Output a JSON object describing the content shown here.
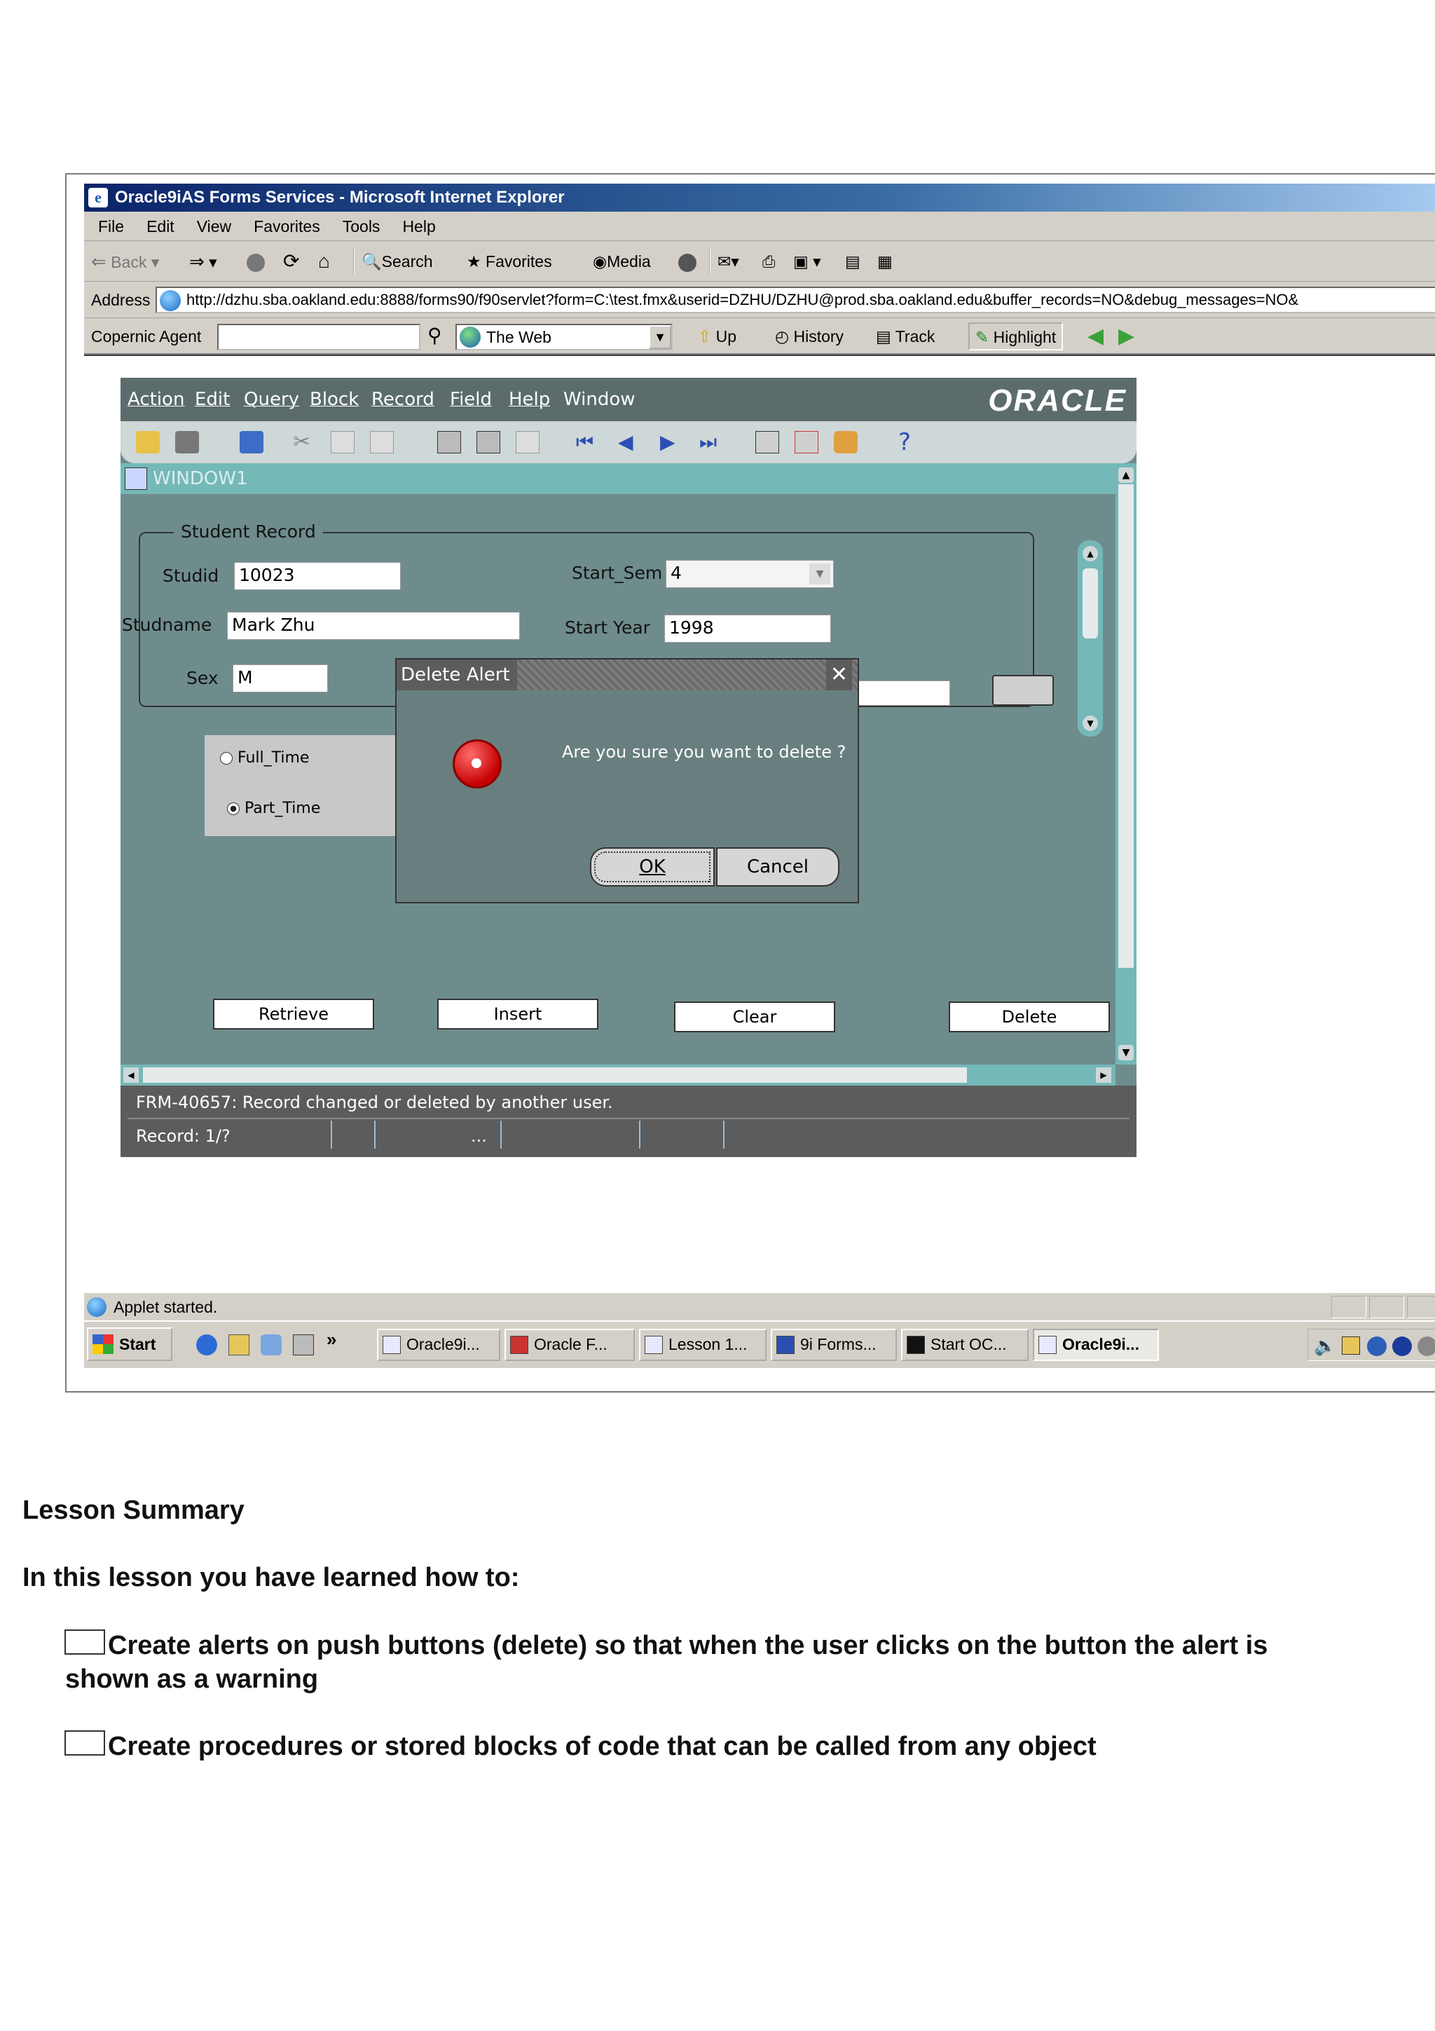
{
  "browser": {
    "title": "Oracle9iAS Forms Services - Microsoft Internet Explorer",
    "menu": [
      "File",
      "Edit",
      "View",
      "Favorites",
      "Tools",
      "Help"
    ],
    "toolbar": {
      "back": "Back",
      "search": "Search",
      "favorites": "Favorites",
      "media": "Media"
    },
    "address_label": "Address",
    "address_url": "http://dzhu.sba.oakland.edu:8888/forms90/f90servlet?form=C:\\test.fmx&userid=DZHU/DZHU@prod.sba.oakland.edu&buffer_records=NO&debug_messages=NO&",
    "links": {
      "agent_label": "Copernic Agent",
      "agent_scope": "The Web",
      "up": "Up",
      "history": "History",
      "track": "Track",
      "highlight": "Highlight"
    },
    "status": "Applet started."
  },
  "oracle_form": {
    "menu": [
      "Action",
      "Edit",
      "Query",
      "Block",
      "Record",
      "Field",
      "Help",
      "Window"
    ],
    "logo": "ORACLE",
    "window_title": "WINDOW1",
    "frame_title": "Student Record",
    "fields": {
      "studid_label": "Studid",
      "studid_value": "10023",
      "studname_label": "Studname",
      "studname_value": "Mark Zhu",
      "sex_label": "Sex",
      "sex_value": "M",
      "start_sem_label": "Start_Sem",
      "start_sem_value": "4",
      "start_year_label": "Start Year",
      "start_year_value": "1998"
    },
    "radio": {
      "full_time": "Full_Time",
      "part_time": "Part_Time",
      "selected": "Part_Time"
    },
    "buttons": {
      "retrieve": "Retrieve",
      "insert": "Insert",
      "clear": "Clear",
      "delete": "Delete"
    },
    "dialog": {
      "title": "Delete Alert",
      "message": "Are you sure you want to delete ?",
      "ok": "OK",
      "cancel": "Cancel"
    },
    "message_line": "FRM-40657: Record changed or deleted by another user.",
    "record_line": "Record: 1/?",
    "record_ellipsis": "..."
  },
  "taskbar": {
    "start": "Start",
    "chevron": "»",
    "tasks": [
      "Oracle9i...",
      "Oracle F...",
      "Lesson 1...",
      "9i Forms...",
      "Start OC...",
      "Oracle9i..."
    ]
  },
  "document": {
    "heading": "Lesson Summary",
    "intro": "In this lesson you have learned how to:",
    "bullet1_line1": "Create alerts on push buttons (delete) so that when the user clicks on the button the alert is",
    "bullet1_line2": "shown as a warning",
    "bullet2": "Create procedures or stored blocks of code that can be called from any object"
  }
}
